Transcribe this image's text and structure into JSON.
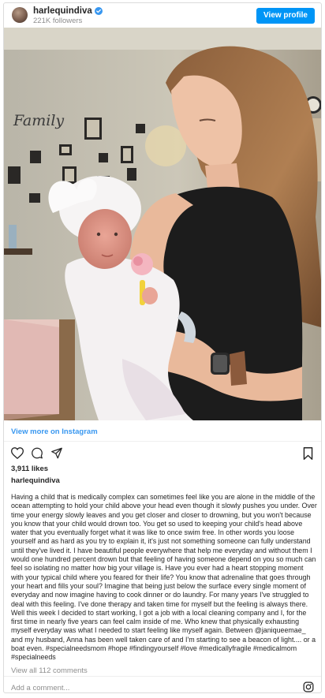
{
  "header": {
    "username": "harlequindiva",
    "followers": "221K followers",
    "view_profile_label": "View profile"
  },
  "post": {
    "photo_description": "",
    "view_more_label": "View more on Instagram",
    "likes": "3,911 likes",
    "poster_username": "harlequindiva",
    "caption": "Having a child that is medically complex can sometimes feel like you are alone in the middle of the ocean attempting to hold your child above your head even though it slowly pushes you under. Over time your energy slowly leaves and you get closer and closer to drowning, but you won't because you know that your child would drown too. You get so used to keeping your child's head above water that you eventually forget what it was like to once swim free. In other words you loose yourself and as hard as you try to explain it, it's just not something someone can fully understand until they've lived it. I have beautiful people everywhere that help me everyday and without them I would one hundred percent drown but that feeling of having someone depend on you so much can feel so isolating no matter how big your village is. Have you ever had a heart stopping moment with your typical child where you feared for their life? You know that adrenaline that goes through your heart and fills your soul? Imagine that being just below the surface every single moment of everyday and now imagine having to cook dinner or do laundry. For many years I've struggled to deal with this feeling. I've done therapy and taken time for myself but the feeling is always there. Well this week I decided to start working, I got a job with a local cleaning company and I, for the first time in nearly five years can feel calm inside of me. Who knew that physically exhausting myself everyday was what I needed to start feeling like myself again. Between @janiqueemae_ and my husband, Anna has been well taken care of and I'm starting to see a beacon of light.... or a boat even. #specialneedsmom #hope #findingyourself #love #medicallyfragile #medicalmom #specialneeds",
    "view_all_comments": "View all 112 comments",
    "add_comment_placeholder": "Add a comment..."
  },
  "wall_sign": "Family",
  "icons": {
    "verified": "verified-badge-icon",
    "like": "heart-icon",
    "comment": "comment-icon",
    "share": "share-icon",
    "save": "bookmark-icon",
    "brand": "instagram-icon"
  },
  "colors": {
    "accent": "#0095f6",
    "link": "#3897f0",
    "muted": "#8e8e8e",
    "text": "#262626"
  }
}
